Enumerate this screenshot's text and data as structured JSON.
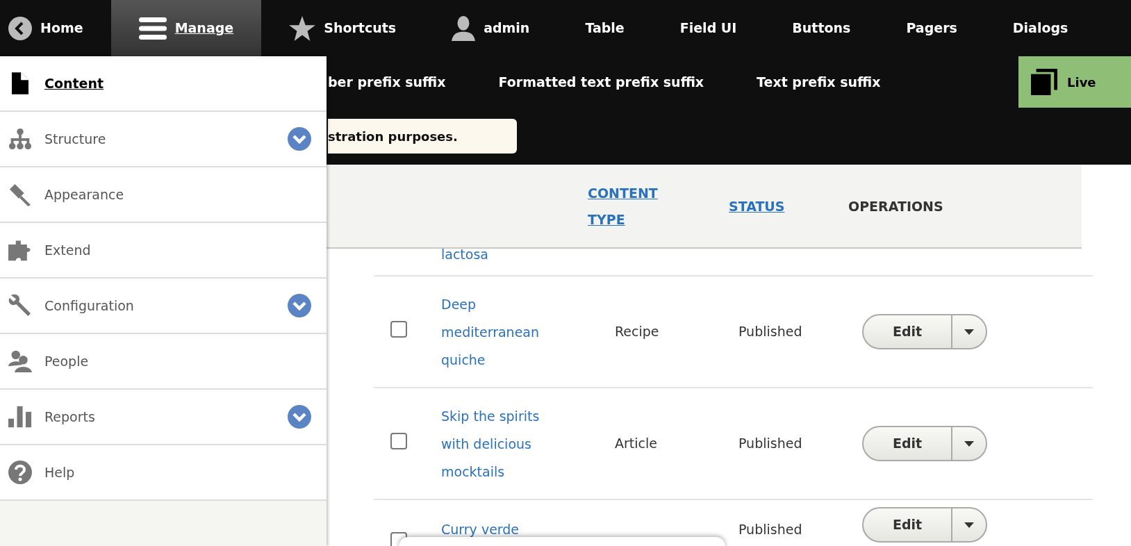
{
  "toolbar": {
    "items": [
      {
        "label": "Home",
        "kind": "icon",
        "selected": false
      },
      {
        "label": "Manage",
        "kind": "icon",
        "selected": true
      },
      {
        "label": "Shortcuts",
        "kind": "icon",
        "selected": false
      },
      {
        "label": "admin",
        "kind": "icon",
        "selected": false
      },
      {
        "label": "Table",
        "kind": "text",
        "selected": false
      },
      {
        "label": "Field UI",
        "kind": "text",
        "selected": false
      },
      {
        "label": "Buttons",
        "kind": "text",
        "selected": false
      },
      {
        "label": "Pagers",
        "kind": "text",
        "selected": false
      },
      {
        "label": "Dialogs",
        "kind": "text",
        "selected": false
      }
    ]
  },
  "tray": {
    "items": [
      {
        "label": "ber prefix suffix"
      },
      {
        "label": "Formatted text prefix suffix"
      },
      {
        "label": "Text prefix suffix"
      }
    ],
    "live_button": {
      "label": "Live"
    }
  },
  "message": {
    "text": "stration purposes."
  },
  "sidebar": {
    "items": [
      {
        "label": "Content",
        "selected": true,
        "expandable": false
      },
      {
        "label": "Structure",
        "selected": false,
        "expandable": true
      },
      {
        "label": "Appearance",
        "selected": false,
        "expandable": false
      },
      {
        "label": "Extend",
        "selected": false,
        "expandable": false
      },
      {
        "label": "Configuration",
        "selected": false,
        "expandable": true
      },
      {
        "label": "People",
        "selected": false,
        "expandable": false
      },
      {
        "label": "Reports",
        "selected": false,
        "expandable": true
      },
      {
        "label": "Help",
        "selected": false,
        "expandable": false
      }
    ]
  },
  "table": {
    "columns": [
      {
        "label": "CONTENT TYPE",
        "sortable": true
      },
      {
        "label": "STATUS",
        "sortable": true
      },
      {
        "label": "OPERATIONS",
        "sortable": false
      }
    ],
    "rows": [
      {
        "title": "lactosa"
      },
      {
        "title": "Deep mediterranean quiche",
        "content_type": "Recipe",
        "status": "Published",
        "checked": false,
        "operation": "Edit"
      },
      {
        "title": "Skip the spirits with delicious mocktails",
        "content_type": "Article",
        "status": "Published",
        "checked": false,
        "operation": "Edit"
      },
      {
        "title": "Curry verde",
        "status": "Published",
        "checked": false,
        "operation": "Edit"
      }
    ]
  }
}
